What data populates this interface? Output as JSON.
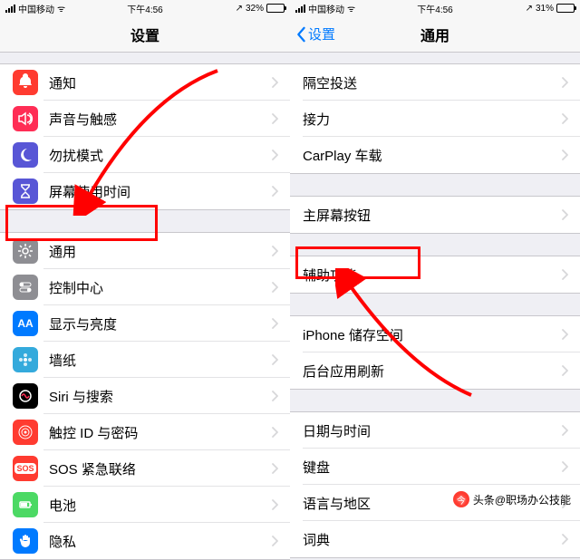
{
  "status": {
    "carrier": "中国移动",
    "time": "下午4:56",
    "battery1": "32%",
    "battery2": "31%",
    "location": "↗"
  },
  "left": {
    "title": "设置",
    "groups": [
      [
        {
          "icon": "bell",
          "bg": "#ff3b30",
          "label": "通知"
        },
        {
          "icon": "sound",
          "bg": "#ff2d55",
          "label": "声音与触感"
        },
        {
          "icon": "moon",
          "bg": "#5856d6",
          "label": "勿扰模式"
        },
        {
          "icon": "hourglass",
          "bg": "#5856d6",
          "label": "屏幕使用时间"
        }
      ],
      [
        {
          "icon": "gear",
          "bg": "#8e8e93",
          "label": "通用",
          "highlight": true
        },
        {
          "icon": "switches",
          "bg": "#8e8e93",
          "label": "控制中心"
        },
        {
          "icon": "AA",
          "bg": "#007aff",
          "label": "显示与亮度"
        },
        {
          "icon": "flower",
          "bg": "#34aadc",
          "label": "墙纸"
        },
        {
          "icon": "siri",
          "bg": "#000",
          "label": "Siri 与搜索"
        },
        {
          "icon": "touch",
          "bg": "#ff3b30",
          "label": "触控 ID 与密码"
        },
        {
          "icon": "SOS",
          "bg": "#ff3b30",
          "label": "SOS 紧急联络"
        },
        {
          "icon": "batt",
          "bg": "#4cd964",
          "label": "电池"
        },
        {
          "icon": "hand",
          "bg": "#007aff",
          "label": "隐私"
        }
      ]
    ]
  },
  "right": {
    "back": "设置",
    "title": "通用",
    "groups": [
      [
        {
          "label": "隔空投送"
        },
        {
          "label": "接力"
        },
        {
          "label": "CarPlay 车载"
        }
      ],
      [
        {
          "label": "主屏幕按钮"
        }
      ],
      [
        {
          "label": "辅助功能",
          "highlight": true
        }
      ],
      [
        {
          "label": "iPhone 储存空间"
        },
        {
          "label": "后台应用刷新"
        }
      ],
      [
        {
          "label": "日期与时间"
        },
        {
          "label": "键盘"
        },
        {
          "label": "语言与地区"
        },
        {
          "label": "词典"
        }
      ]
    ]
  },
  "watermark": "头条@职场办公技能"
}
